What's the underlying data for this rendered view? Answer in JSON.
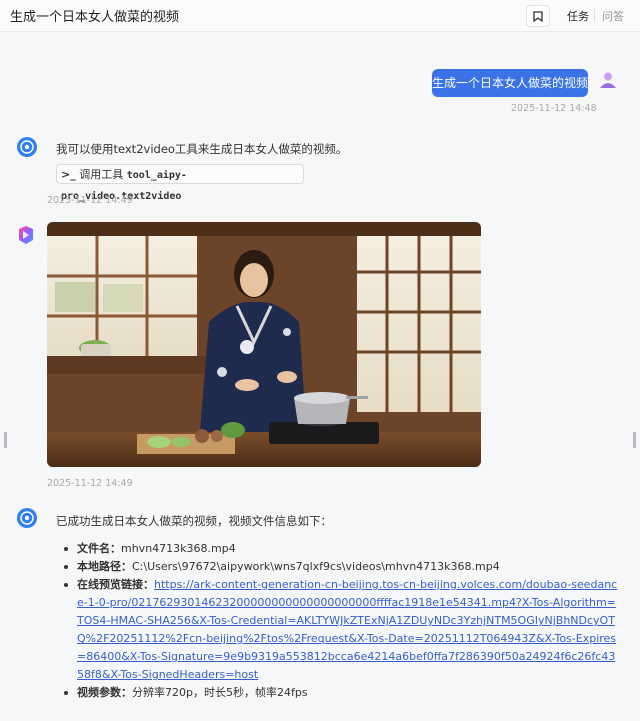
{
  "header": {
    "title": "生成一个日本女人做菜的视频",
    "tabs": [
      "任务",
      "问答"
    ]
  },
  "user_message": {
    "text": "生成一个日本女人做菜的视频",
    "timestamp": "2025-11-12 14:48"
  },
  "assistant_message_1": {
    "text": "我可以使用text2video工具来生成日本女人做菜的视频。",
    "tool_prefix": "调用工具",
    "tool_name": "tool_aipy-pro_video.text2video",
    "timestamp": "2025-11-12 14:49"
  },
  "video_message": {
    "timestamp": "2025-11-12 14:49",
    "icon": "gradient-app-icon"
  },
  "assistant_message_2": {
    "intro": "已成功生成日本女人做菜的视频，视频文件信息如下：",
    "items": [
      {
        "label": "文件名",
        "value": "mhvn4713k368.mp4"
      },
      {
        "label": "本地路径",
        "value": "C:\\Users\\97672\\aipywork\\wns7qlxf9cs\\videos\\mhvn4713k368.mp4"
      },
      {
        "label": "在线预览链接",
        "value": "https://ark-content-generation-cn-beijing.tos-cn-beijing.volces.com/doubao-seedance-1-0-pro/02176293014623200000000000000000000ffffac1918e1e54341.mp4?X-Tos-Algorithm=TOS4-HMAC-SHA256&X-Tos-Credential=AKLTYWJkZTExNjA1ZDUyNDc3YzhjNTM5OGIyNjBhNDcyOTQ%2F20251112%2Fcn-beijing%2Ftos%2Frequest&X-Tos-Date=20251112T064943Z&X-Tos-Expires=86400&X-Tos-Signature=9e9b9319a553812bcca6e4214a6bef0ffa7f286390f50a24924f6c26fc4358f8&X-Tos-SignedHeaders=host"
      },
      {
        "label": "视频参数",
        "value": "分辨率720p，时长5秒，帧率24fps"
      }
    ]
  },
  "colors": {
    "accent": "#3b72e6",
    "link": "#3760c7"
  }
}
